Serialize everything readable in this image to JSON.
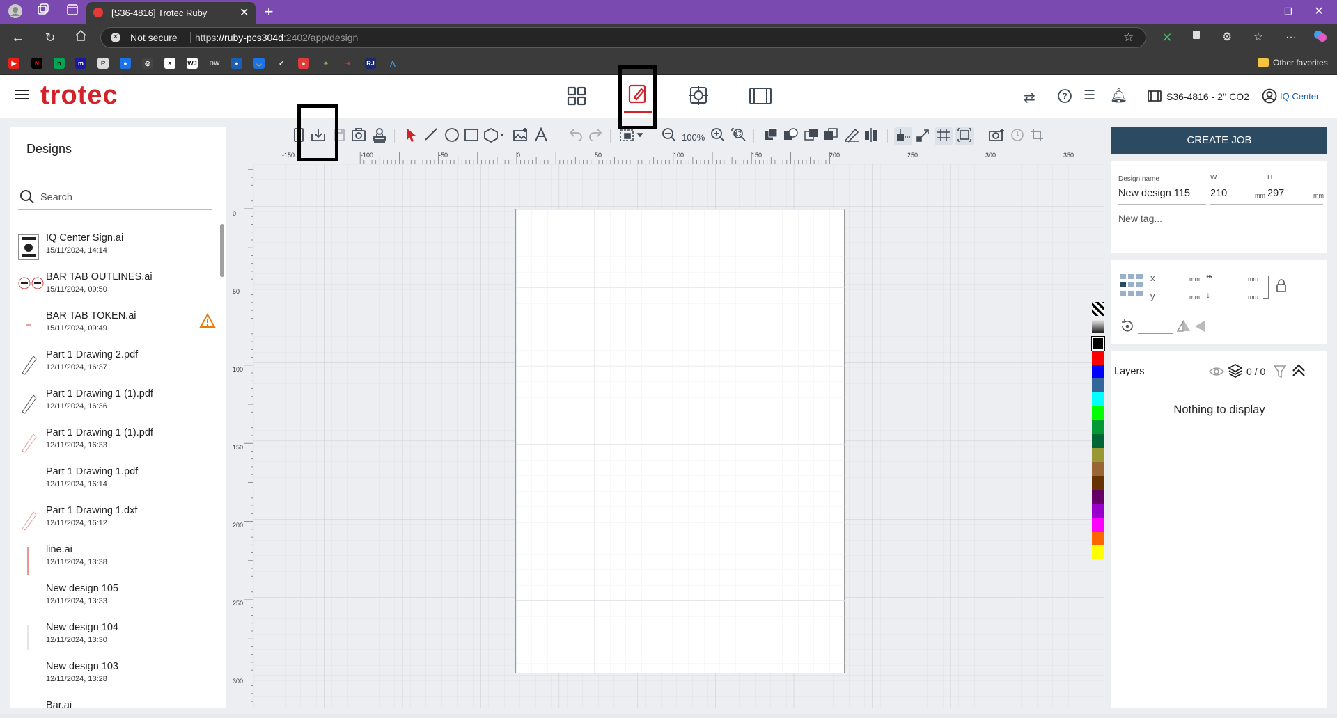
{
  "browser": {
    "tab_title": "[S36-4816] Trotec Ruby",
    "security_label": "Not secure",
    "url_scheme": "https",
    "url_host": "://ruby-pcs304d",
    "url_path": ":2402/app/design",
    "other_favorites": "Other favorites"
  },
  "app": {
    "logo": "trotec",
    "machine_label": "S36-4816 - 2'' CO2",
    "account_label": "IQ Center"
  },
  "designs": {
    "title": "Designs",
    "search_placeholder": "Search",
    "items": [
      {
        "name": "IQ Center Sign.ai",
        "date": "15/11/2024, 14:14"
      },
      {
        "name": "BAR TAB OUTLINES.ai",
        "date": "15/11/2024, 09:50"
      },
      {
        "name": "BAR TAB TOKEN.ai",
        "date": "15/11/2024, 09:49"
      },
      {
        "name": "Part 1 Drawing 2.pdf",
        "date": "12/11/2024, 16:37"
      },
      {
        "name": "Part 1 Drawing 1 (1).pdf",
        "date": "12/11/2024, 16:36"
      },
      {
        "name": "Part 1 Drawing 1 (1).pdf",
        "date": "12/11/2024, 16:33"
      },
      {
        "name": "Part 1 Drawing 1.pdf",
        "date": "12/11/2024, 16:14"
      },
      {
        "name": "Part 1 Drawing 1.dxf",
        "date": "12/11/2024, 16:12"
      },
      {
        "name": "line.ai",
        "date": "12/11/2024, 13:38"
      },
      {
        "name": "New design 105",
        "date": "12/11/2024, 13:33"
      },
      {
        "name": "New design 104",
        "date": "12/11/2024, 13:30"
      },
      {
        "name": "New design 103",
        "date": "12/11/2024, 13:28"
      },
      {
        "name": "Bar.ai",
        "date": ""
      }
    ]
  },
  "toolbar": {
    "zoom_label": "100%"
  },
  "ruler": {
    "top_labels": [
      "-150",
      "-100",
      "-50",
      "0",
      "50",
      "100",
      "150",
      "200",
      "250",
      "300",
      "350"
    ],
    "left_labels": [
      "0",
      "50",
      "100",
      "150",
      "200",
      "250",
      "300"
    ]
  },
  "job": {
    "create_label": "CREATE JOB",
    "design_name_label": "Design name",
    "design_name": "New design 115",
    "w_label": "W",
    "w_value": "210",
    "w_unit": "mm",
    "h_label": "H",
    "h_value": "297",
    "h_unit": "mm",
    "tag_placeholder": "New tag...",
    "x_label": "x",
    "y_label": "y",
    "mm": "mm"
  },
  "layers": {
    "title": "Layers",
    "count": "0 / 0",
    "empty": "Nothing to display"
  },
  "palette": [
    "#000000",
    "#7f7f7f",
    "#000000",
    "#ff0000",
    "#0000ff",
    "#336699",
    "#00ffff",
    "#00ff00",
    "#009933",
    "#006633",
    "#999933",
    "#996633",
    "#663300",
    "#660066",
    "#9900cc",
    "#ff00ff",
    "#ff6600",
    "#ffff00"
  ]
}
